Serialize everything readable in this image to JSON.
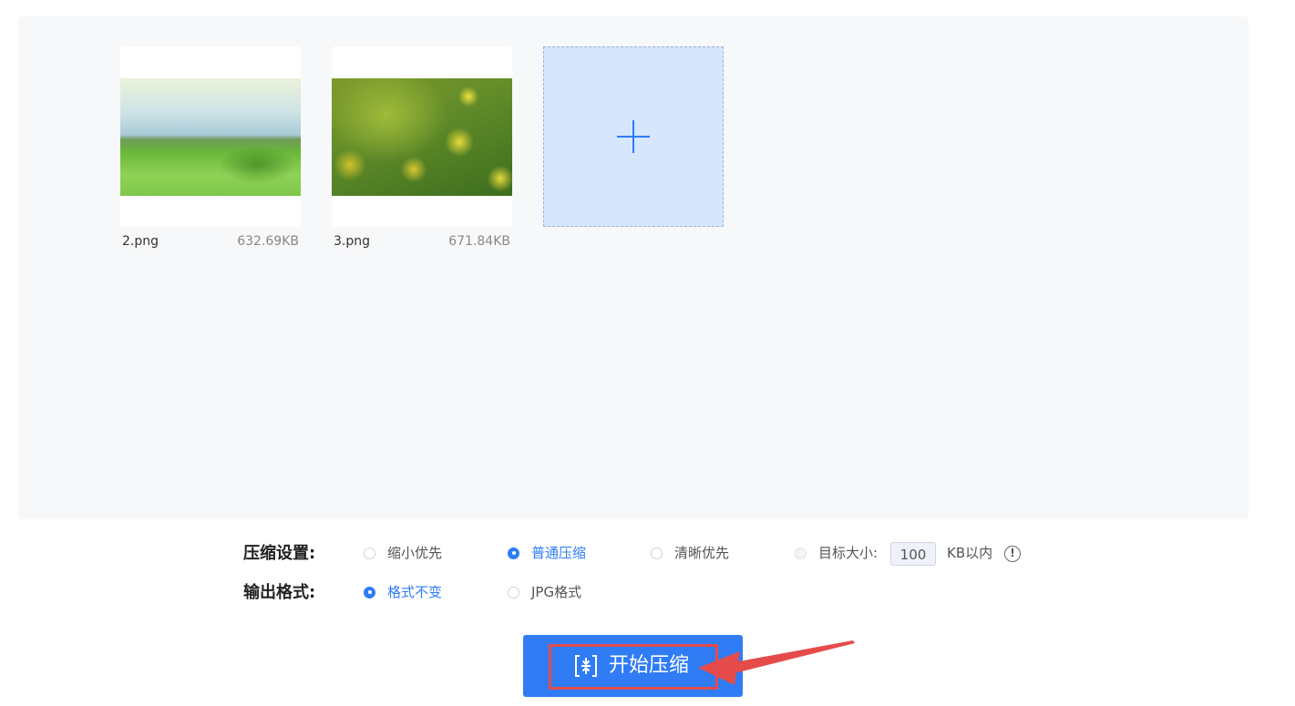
{
  "files": [
    {
      "name": "2.png",
      "size": "632.69KB",
      "thumbnail": "meadow-landscape-image"
    },
    {
      "name": "3.png",
      "size": "671.84KB",
      "thumbnail": "yellow-flowers-image"
    }
  ],
  "add_icon": "plus-icon",
  "compression": {
    "label": "压缩设置:",
    "options": [
      {
        "label": "缩小优先",
        "selected": false
      },
      {
        "label": "普通压缩",
        "selected": true
      },
      {
        "label": "清晰优先",
        "selected": false
      },
      {
        "label": "目标大小:",
        "selected": false
      }
    ],
    "target_size_value": "100",
    "target_size_unit": "KB以内",
    "info_icon": "info-icon"
  },
  "output_format": {
    "label": "输出格式:",
    "options": [
      {
        "label": "格式不变",
        "selected": true
      },
      {
        "label": "JPG格式",
        "selected": false
      }
    ]
  },
  "start_button": {
    "label": "开始压缩",
    "icon": "compress-icon"
  },
  "colors": {
    "accent": "#2f7cf5",
    "panel": "#f7f8fa",
    "add_box": "#d6e6fd",
    "annotation": "#e64b4b"
  }
}
